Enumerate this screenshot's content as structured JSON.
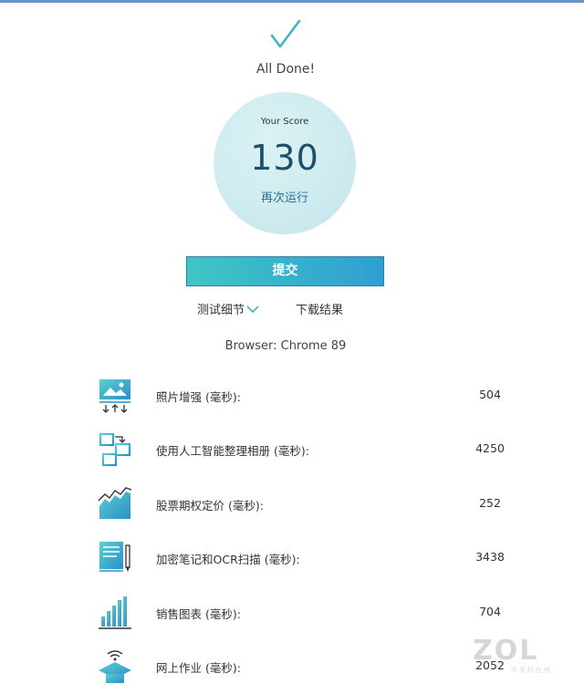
{
  "result": {
    "done_text": "All Done!",
    "score_label": "Your Score",
    "score_value": "130",
    "rerun_label": "再次运行"
  },
  "actions": {
    "submit_label": "提交",
    "details_label": "测试细节",
    "download_label": "下载结果"
  },
  "browser_info": "Browser: Chrome 89",
  "colors": {
    "accent_teal": "#3fc6c5",
    "accent_blue": "#2f9fd2",
    "score_text": "#1f4e6e"
  },
  "results": [
    {
      "icon": "photo-enhance-icon",
      "name": "照片增强 (毫秒):",
      "value": "504"
    },
    {
      "icon": "ai-album-icon",
      "name": "使用人工智能整理相册 (毫秒):",
      "value": "4250"
    },
    {
      "icon": "stock-chart-icon",
      "name": "股票期权定价 (毫秒):",
      "value": "252"
    },
    {
      "icon": "notes-ocr-icon",
      "name": "加密笔记和OCR扫描 (毫秒):",
      "value": "3438"
    },
    {
      "icon": "sales-chart-icon",
      "name": "销售图表 (毫秒):",
      "value": "704"
    },
    {
      "icon": "online-homework-icon",
      "name": "网上作业 (毫秒):",
      "value": "2052"
    }
  ],
  "watermark": {
    "logo": "ZOL",
    "sub": "中关村在线"
  }
}
